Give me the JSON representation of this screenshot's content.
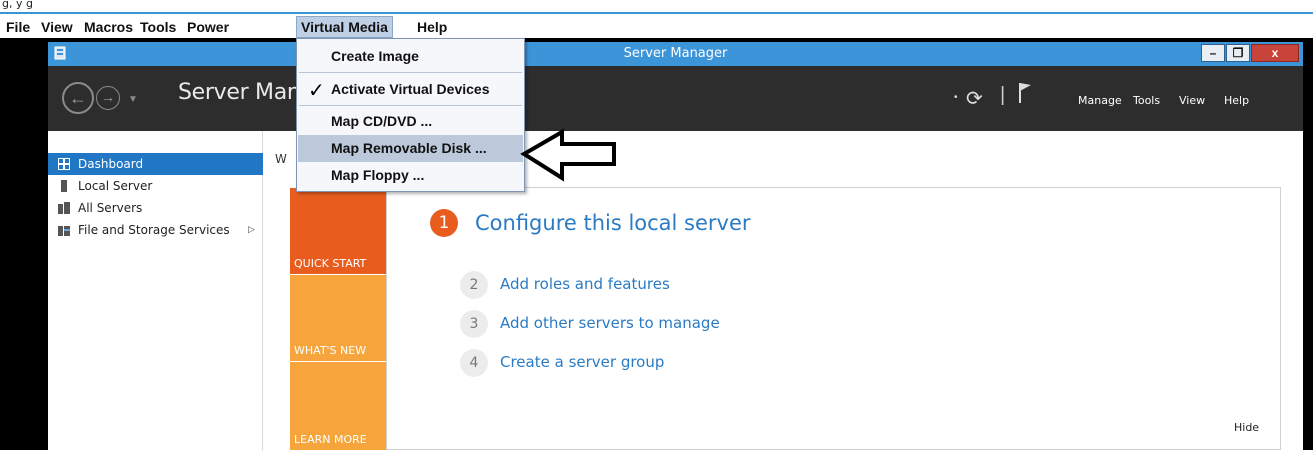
{
  "top_fragment": "g, y g",
  "menubar": {
    "items": [
      "File",
      "View",
      "Macros",
      "Tools",
      "Power",
      "Virtual Media",
      "Help"
    ],
    "active": "Virtual Media"
  },
  "virtual_media_menu": {
    "items": [
      {
        "label": "Create Image",
        "checked": false
      },
      {
        "label": "Activate Virtual Devices",
        "checked": true
      },
      {
        "label": "Map CD/DVD ...",
        "checked": false
      },
      {
        "label": "Map Removable Disk ...",
        "checked": false,
        "highlighted": true
      },
      {
        "label": "Map Floppy ...",
        "checked": false
      }
    ],
    "check_glyph": "✓"
  },
  "window": {
    "title": "Server Manager",
    "min_label": "–",
    "max_label": "❐",
    "close_label": "x"
  },
  "server_manager": {
    "header_title": "Server Manager",
    "header_menu": [
      "Manage",
      "Tools",
      "View",
      "Help"
    ],
    "sidebar": [
      {
        "label": "Dashboard",
        "selected": true,
        "icon": "dashboard-icon"
      },
      {
        "label": "Local Server",
        "selected": false,
        "icon": "server-icon"
      },
      {
        "label": "All Servers",
        "selected": false,
        "icon": "servers-icon"
      },
      {
        "label": "File and Storage Services",
        "selected": false,
        "icon": "storage-icon",
        "arrow": "▷"
      }
    ],
    "welcome_partial": "W",
    "tiles": [
      "QUICK START",
      "WHAT'S NEW",
      "LEARN MORE"
    ],
    "steps": [
      {
        "num": "1",
        "label": "Configure this local server"
      },
      {
        "num": "2",
        "label": "Add roles and features"
      },
      {
        "num": "3",
        "label": "Add other servers to manage"
      },
      {
        "num": "4",
        "label": "Create a server group"
      }
    ],
    "hide_label": "Hide"
  },
  "colors": {
    "titlebar": "#3d95d9",
    "header": "#2d2d2d",
    "selected": "#2276c6",
    "quick_start": "#e85d1e",
    "tile_secondary": "#f5a53b",
    "link": "#2a7bc4"
  }
}
